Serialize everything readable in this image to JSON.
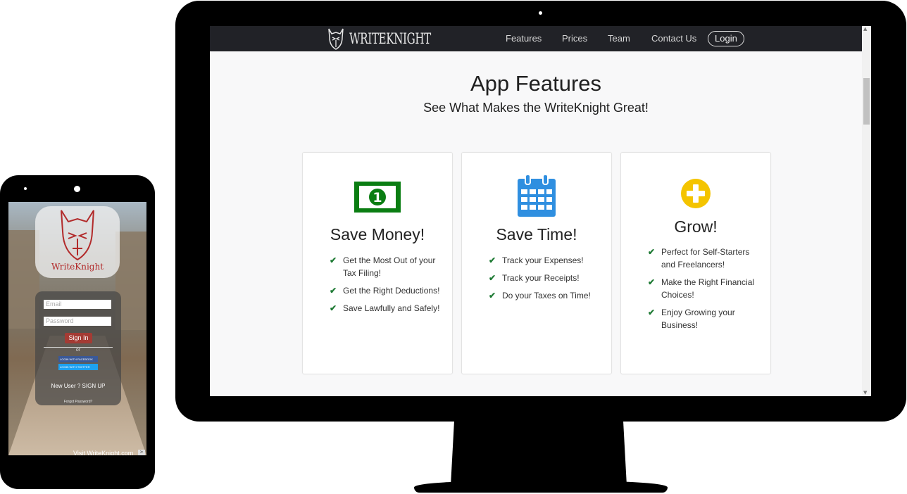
{
  "colors": {
    "navbar_bg": "#212227",
    "page_bg": "#f8f8f9",
    "check_green": "#1e7a34",
    "money_green": "#0a7d12",
    "calendar_blue": "#2f8fe0",
    "plus_yellow": "#f4c400",
    "signin_red": "#a43b34",
    "brand_red": "#b22a2a",
    "facebook_blue": "#3b5998",
    "twitter_blue": "#1da1f2"
  },
  "monitor": {
    "navbar": {
      "brand": "WRITEKNIGHT",
      "links": [
        "Features",
        "Prices",
        "Team",
        "Contact Us"
      ],
      "login": "Login"
    },
    "section": {
      "title": "App Features",
      "subtitle": "See What Makes the WriteKnight Great!"
    },
    "cards": [
      {
        "icon": "dollar-bill-icon",
        "title": "Save Money!",
        "items": [
          "Get the Most Out of your Tax Filing!",
          "Get the Right Deductions!",
          "Save Lawfully and Safely!"
        ]
      },
      {
        "icon": "calendar-icon",
        "title": "Save Time!",
        "items": [
          "Track your Expenses!",
          "Track your Receipts!",
          "Do your Taxes on Time!"
        ]
      },
      {
        "icon": "plus-circle-icon",
        "title": "Grow!",
        "items": [
          "Perfect for Self-Starters and Freelancers!",
          "Make the Right Financial Choices!",
          "Enjoy Growing your Business!"
        ]
      }
    ]
  },
  "phone": {
    "logo_text": "WriteKnight",
    "email_placeholder": "Email",
    "password_placeholder": "Password",
    "signin": "Sign In",
    "or": "or",
    "facebook": "LOGIN WITH FACEBOOK",
    "twitter": "LOGIN WITH TWITTER",
    "signup": "New User ? SIGN UP",
    "forgot": "Forgot Password?",
    "visit": "Visit WriteKnight.com",
    "visit_arrow": ">"
  }
}
